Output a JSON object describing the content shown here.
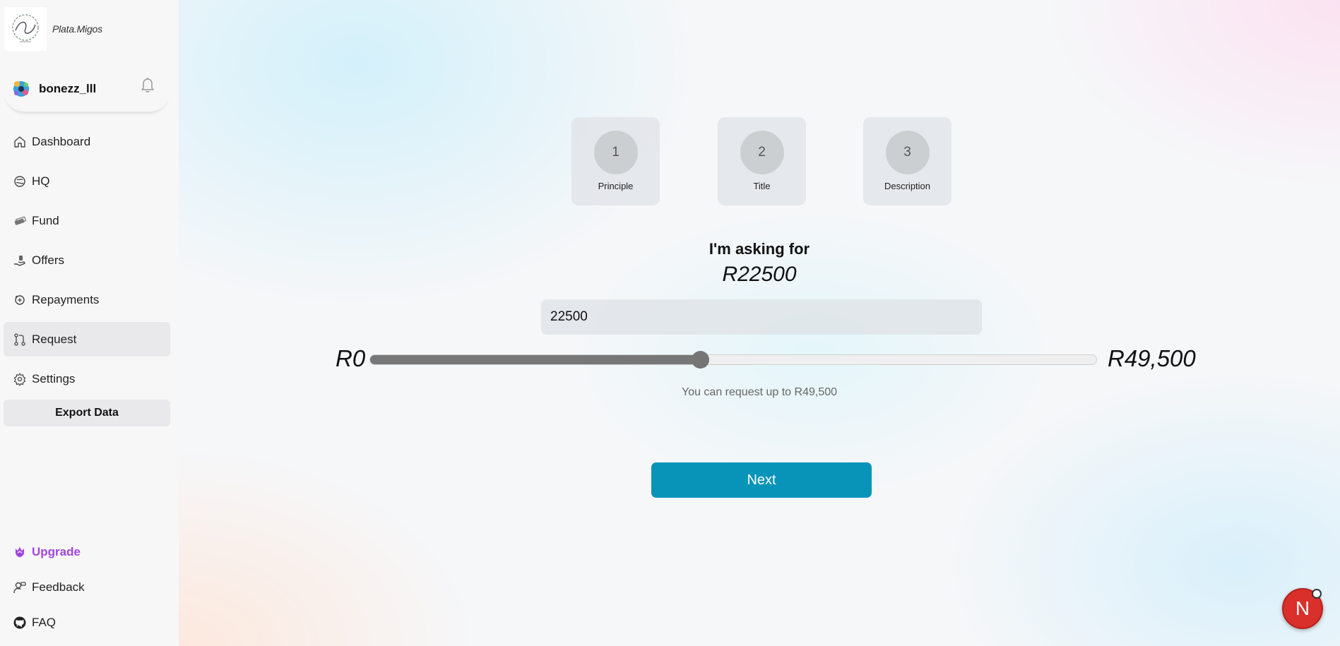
{
  "brand": {
    "name": "Plata.Migos"
  },
  "user": {
    "username": "bonezz_lll"
  },
  "nav": {
    "items": [
      {
        "label": "Dashboard",
        "icon": "home-icon"
      },
      {
        "label": "HQ",
        "icon": "hq-icon"
      },
      {
        "label": "Fund",
        "icon": "money-icon"
      },
      {
        "label": "Offers",
        "icon": "hand-offer-icon"
      },
      {
        "label": "Repayments",
        "icon": "repayments-icon"
      },
      {
        "label": "Request",
        "icon": "git-pull-request-icon",
        "active": true
      },
      {
        "label": "Settings",
        "icon": "gear-icon"
      }
    ],
    "export_label": "Export Data"
  },
  "bottom_nav": {
    "upgrade": "Upgrade",
    "feedback": "Feedback",
    "faq": "FAQ"
  },
  "steps": [
    {
      "number": "1",
      "label": "Principle"
    },
    {
      "number": "2",
      "label": "Title"
    },
    {
      "number": "3",
      "label": "Description"
    }
  ],
  "request": {
    "asking_label": "I'm asking for",
    "asking_amount": "R22500",
    "input_value": "22500",
    "min_label": "R0",
    "max_label": "R49,500",
    "slider_value": 22500,
    "slider_min": 0,
    "slider_max": 49500,
    "hint": "You can request up to R49,500",
    "next_label": "Next"
  },
  "fab": {
    "letter": "N"
  },
  "colors": {
    "accent": "#0894b9",
    "upgrade": "#a045e0",
    "fab": "#d9302c"
  }
}
